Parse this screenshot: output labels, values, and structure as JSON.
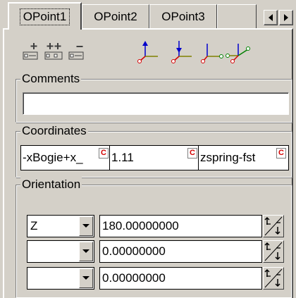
{
  "tabs": [
    {
      "label": "OPoint1",
      "active": true
    },
    {
      "label": "OPoint2",
      "active": false
    },
    {
      "label": "OPoint3",
      "active": false
    }
  ],
  "toolbar": {
    "buttons": [
      "add-point-icon",
      "add-multiple-points-icon",
      "remove-point-icon"
    ],
    "axis_icons": [
      "axis-up-point-icon",
      "axis-down-point-icon",
      "axis-chain-icon",
      "axis-branch-icon"
    ]
  },
  "comments": {
    "title": "Comments",
    "value": ""
  },
  "coordinates": {
    "title": "Coordinates",
    "cells": [
      {
        "value": "-xBogie+x_",
        "mark": "C"
      },
      {
        "value": "1.11",
        "mark": "C"
      },
      {
        "value": "zspring-fst",
        "mark": "C"
      }
    ]
  },
  "orientation": {
    "title": "Orientation",
    "rows": [
      {
        "axis": "Z",
        "value": "180.00000000"
      },
      {
        "axis": "",
        "value": "0.00000000"
      },
      {
        "axis": "",
        "value": "0.00000000"
      }
    ]
  },
  "colors": {
    "face": "#d4d0c8",
    "axis_blue": "#0000cc",
    "point_red": "#d40000",
    "point_green": "#008000",
    "c_mark": "#d40000"
  }
}
